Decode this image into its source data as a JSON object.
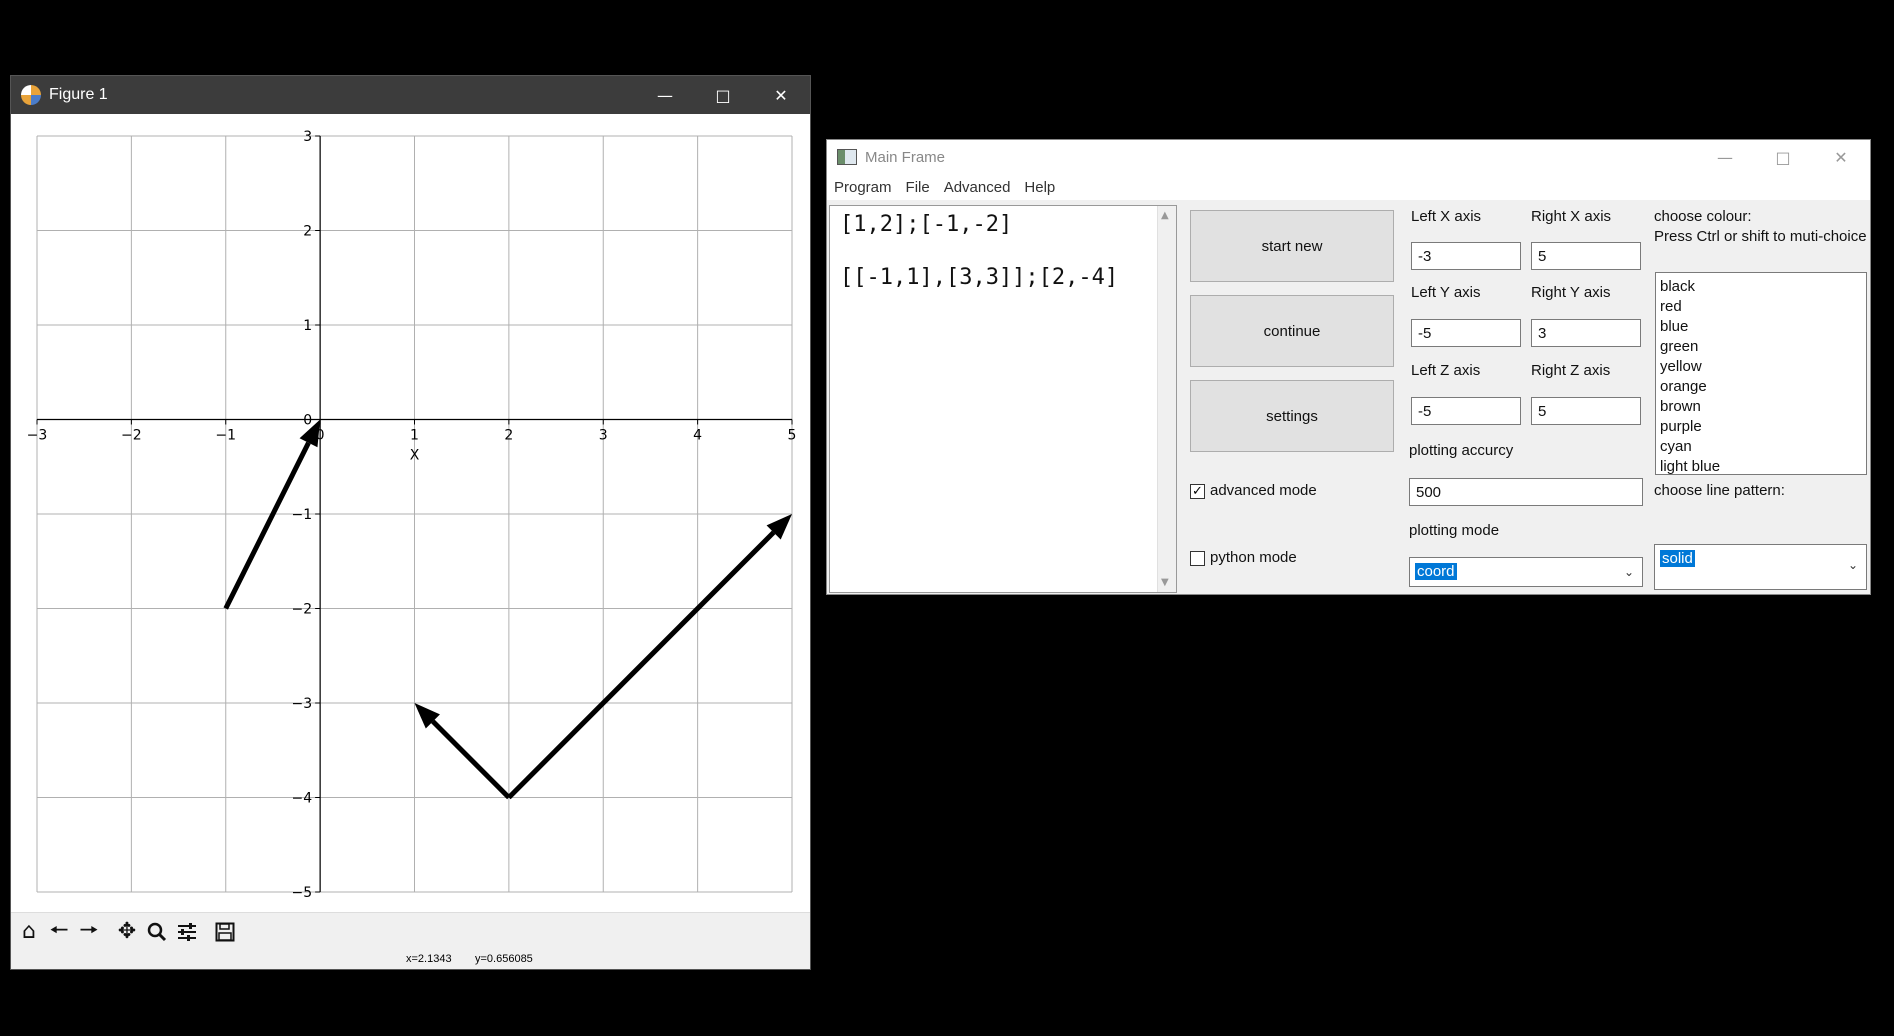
{
  "figure_window": {
    "title": "Figure 1",
    "status": {
      "x": "x=2.1343",
      "y": "y=0.656085"
    }
  },
  "main_window": {
    "title": "Main Frame",
    "menu": [
      "Program",
      "File",
      "Advanced",
      "Help"
    ],
    "editor_lines": [
      "[1,2];[-1,-2]",
      "[[-1,1],[3,3]];[2,-4]"
    ],
    "buttons": {
      "start_new": "start new",
      "continue": "continue",
      "settings": "settings"
    },
    "axes": {
      "left_x_label": "Left X axis",
      "left_x_value": "-3",
      "right_x_label": "Right X axis",
      "right_x_value": "5",
      "left_y_label": "Left Y axis",
      "left_y_value": "-5",
      "right_y_label": "Right Y axis",
      "right_y_value": "3",
      "left_z_label": "Left Z axis",
      "left_z_value": "-5",
      "right_z_label": "Right Z axis",
      "right_z_value": "5"
    },
    "plotting_accuracy_label": "plotting accurcy",
    "plotting_accuracy_value": "500",
    "plotting_mode_label": "plotting mode",
    "plotting_mode_value": "coord",
    "advanced_mode_label": "advanced mode",
    "advanced_mode_checked": true,
    "python_mode_label": "python mode",
    "python_mode_checked": false,
    "colour_label_1": "choose colour:",
    "colour_label_2": "Press Ctrl or shift to muti-choice",
    "colours": [
      "black",
      "red",
      "blue",
      "green",
      "yellow",
      "orange",
      "brown",
      "purple",
      "cyan",
      "light blue"
    ],
    "line_pattern_label": "choose line pattern:",
    "line_pattern_value": "solid"
  },
  "chart_data": {
    "type": "line",
    "xlabel": "X",
    "xlim": [
      -3,
      5
    ],
    "ylim": [
      -5,
      3
    ],
    "xticks": [
      "−3",
      "−2",
      "−1",
      "0",
      "1",
      "2",
      "3",
      "4",
      "5"
    ],
    "yticks": [
      "3",
      "2",
      "1",
      "0",
      "−1",
      "−2",
      "−3",
      "−4",
      "−5"
    ],
    "grid": true,
    "arrows": [
      {
        "from": [
          -1,
          -2
        ],
        "to": [
          0,
          0
        ]
      },
      {
        "from": [
          2,
          -4
        ],
        "to": [
          1,
          -3
        ]
      },
      {
        "from": [
          2,
          -4
        ],
        "to": [
          5,
          -1
        ]
      }
    ],
    "color": "#000000"
  }
}
